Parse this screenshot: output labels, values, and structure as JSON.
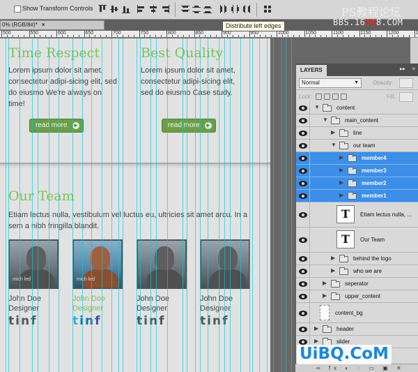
{
  "optionsbar": {
    "show_transform_controls_label": "Show Transform Controls",
    "show_transform_controls_checked": false,
    "align_buttons": [
      "align-top-edges",
      "align-vertical-centers",
      "align-bottom-edges",
      "align-left-edges",
      "align-horizontal-centers",
      "align-right-edges"
    ],
    "distribute_buttons": [
      "distribute-top-edges",
      "distribute-vertical-centers",
      "distribute-bottom-edges",
      "distribute-left-edges",
      "distribute-horizontal-centers",
      "distribute-right-edges"
    ],
    "auto_align_icon": "auto-align-layers-icon",
    "tooltip": "Distribute left edges"
  },
  "watermarks": {
    "top": "PS教程论坛",
    "url_prefix": "BBS.16",
    "url_red": "XX",
    "url_suffix": "8.COM",
    "bottom": "UiBQ.CoM"
  },
  "document": {
    "tab_label": "0% (RGB/8#)",
    "tab_suffix": "*",
    "close_glyph": "×",
    "ruler_labels": [
      "500",
      "550",
      "600",
      "650",
      "700",
      "750",
      "800",
      "850",
      "900",
      "950",
      "1000",
      "1050",
      "1100",
      "1150",
      "1200",
      "1250"
    ]
  },
  "canvas": {
    "col1": {
      "heading": "Time Respect",
      "text": "Lorem ipsum dolor sit amet, consectetur adipi-sicing elit, sed do eiusmo We're always on time!",
      "button": "read more"
    },
    "col2": {
      "heading": "Best Quality",
      "text": "Lorem ipsum dolor sit amet, consectetur adipi-sicing elit, sed do eiusmo Case study.",
      "button": "read more"
    },
    "team": {
      "heading": "Our Team",
      "intro": "Etiam lectus nulla, vestibulum vel luctus eu, ultricies sit amet arcu. In a sem a nibh fringilla blandit.",
      "members": [
        {
          "name": "John Doe",
          "role": "Designer",
          "caption": "mich led",
          "active": false
        },
        {
          "name": "John Doe",
          "role": "Designer",
          "caption": "mich led",
          "active": true
        },
        {
          "name": "John Doe",
          "role": "Designer",
          "caption": "",
          "active": false
        },
        {
          "name": "John Doe",
          "role": "Designer",
          "caption": "",
          "active": false
        }
      ],
      "social_icons": [
        "twitter-icon",
        "linkedin-icon",
        "facebook-icon"
      ],
      "social_glyphs": [
        "t",
        "in",
        "f"
      ]
    }
  },
  "layers_panel": {
    "tab": "LAYERS",
    "collapse_glyph": "▸▸",
    "menu_glyph": "≡",
    "blend_mode": "Normal",
    "opacity_label": "Opacity:",
    "fill_label": "Fill:",
    "lock_label": "Lock:",
    "rows": [
      {
        "name": "content",
        "kind": "group",
        "depth": 0,
        "expanded": true,
        "selected": false
      },
      {
        "name": "main_content",
        "kind": "group",
        "depth": 1,
        "expanded": true,
        "selected": false
      },
      {
        "name": "line",
        "kind": "group",
        "depth": 2,
        "expanded": false,
        "selected": false
      },
      {
        "name": "our team",
        "kind": "group",
        "depth": 2,
        "expanded": true,
        "selected": false
      },
      {
        "name": "member4",
        "kind": "group",
        "depth": 3,
        "expanded": false,
        "selected": true
      },
      {
        "name": "member3",
        "kind": "group",
        "depth": 3,
        "expanded": false,
        "selected": true
      },
      {
        "name": "member2",
        "kind": "group",
        "depth": 3,
        "expanded": false,
        "selected": true
      },
      {
        "name": "member1",
        "kind": "group",
        "depth": 3,
        "expanded": false,
        "selected": true
      },
      {
        "name": "Etiam lectus nulla, ...",
        "kind": "text",
        "depth": 3,
        "expanded": false,
        "selected": false
      },
      {
        "name": "Our Team",
        "kind": "text",
        "depth": 3,
        "expanded": false,
        "selected": false
      },
      {
        "name": "behind the logo",
        "kind": "group",
        "depth": 2,
        "expanded": false,
        "selected": false
      },
      {
        "name": "who we are",
        "kind": "group",
        "depth": 2,
        "expanded": false,
        "selected": false
      },
      {
        "name": "seperator",
        "kind": "group",
        "depth": 1,
        "expanded": false,
        "selected": false
      },
      {
        "name": "upper_content",
        "kind": "group",
        "depth": 1,
        "expanded": false,
        "selected": false
      },
      {
        "name": "content_bg",
        "kind": "layer",
        "depth": 1,
        "expanded": false,
        "selected": false
      },
      {
        "name": "header",
        "kind": "group",
        "depth": 0,
        "expanded": false,
        "selected": false
      },
      {
        "name": "slider",
        "kind": "group",
        "depth": 0,
        "expanded": false,
        "selected": false
      }
    ],
    "footer_glyphs": "∞ fx ◐ ◌ ▭ ▣ ✕"
  }
}
